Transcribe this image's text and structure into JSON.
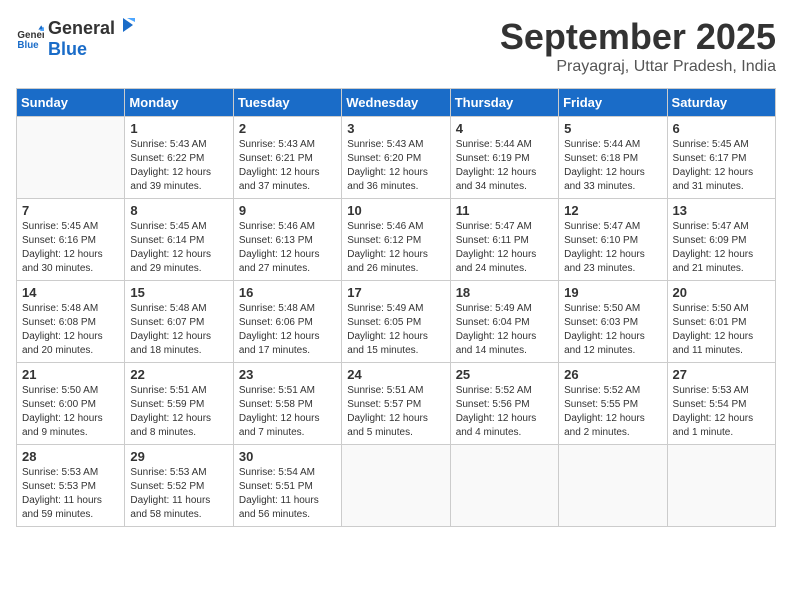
{
  "logo": {
    "general": "General",
    "blue": "Blue"
  },
  "title": "September 2025",
  "subtitle": "Prayagraj, Uttar Pradesh, India",
  "days_of_week": [
    "Sunday",
    "Monday",
    "Tuesday",
    "Wednesday",
    "Thursday",
    "Friday",
    "Saturday"
  ],
  "weeks": [
    [
      {
        "day": "",
        "info": ""
      },
      {
        "day": "1",
        "info": "Sunrise: 5:43 AM\nSunset: 6:22 PM\nDaylight: 12 hours\nand 39 minutes."
      },
      {
        "day": "2",
        "info": "Sunrise: 5:43 AM\nSunset: 6:21 PM\nDaylight: 12 hours\nand 37 minutes."
      },
      {
        "day": "3",
        "info": "Sunrise: 5:43 AM\nSunset: 6:20 PM\nDaylight: 12 hours\nand 36 minutes."
      },
      {
        "day": "4",
        "info": "Sunrise: 5:44 AM\nSunset: 6:19 PM\nDaylight: 12 hours\nand 34 minutes."
      },
      {
        "day": "5",
        "info": "Sunrise: 5:44 AM\nSunset: 6:18 PM\nDaylight: 12 hours\nand 33 minutes."
      },
      {
        "day": "6",
        "info": "Sunrise: 5:45 AM\nSunset: 6:17 PM\nDaylight: 12 hours\nand 31 minutes."
      }
    ],
    [
      {
        "day": "7",
        "info": "Sunrise: 5:45 AM\nSunset: 6:16 PM\nDaylight: 12 hours\nand 30 minutes."
      },
      {
        "day": "8",
        "info": "Sunrise: 5:45 AM\nSunset: 6:14 PM\nDaylight: 12 hours\nand 29 minutes."
      },
      {
        "day": "9",
        "info": "Sunrise: 5:46 AM\nSunset: 6:13 PM\nDaylight: 12 hours\nand 27 minutes."
      },
      {
        "day": "10",
        "info": "Sunrise: 5:46 AM\nSunset: 6:12 PM\nDaylight: 12 hours\nand 26 minutes."
      },
      {
        "day": "11",
        "info": "Sunrise: 5:47 AM\nSunset: 6:11 PM\nDaylight: 12 hours\nand 24 minutes."
      },
      {
        "day": "12",
        "info": "Sunrise: 5:47 AM\nSunset: 6:10 PM\nDaylight: 12 hours\nand 23 minutes."
      },
      {
        "day": "13",
        "info": "Sunrise: 5:47 AM\nSunset: 6:09 PM\nDaylight: 12 hours\nand 21 minutes."
      }
    ],
    [
      {
        "day": "14",
        "info": "Sunrise: 5:48 AM\nSunset: 6:08 PM\nDaylight: 12 hours\nand 20 minutes."
      },
      {
        "day": "15",
        "info": "Sunrise: 5:48 AM\nSunset: 6:07 PM\nDaylight: 12 hours\nand 18 minutes."
      },
      {
        "day": "16",
        "info": "Sunrise: 5:48 AM\nSunset: 6:06 PM\nDaylight: 12 hours\nand 17 minutes."
      },
      {
        "day": "17",
        "info": "Sunrise: 5:49 AM\nSunset: 6:05 PM\nDaylight: 12 hours\nand 15 minutes."
      },
      {
        "day": "18",
        "info": "Sunrise: 5:49 AM\nSunset: 6:04 PM\nDaylight: 12 hours\nand 14 minutes."
      },
      {
        "day": "19",
        "info": "Sunrise: 5:50 AM\nSunset: 6:03 PM\nDaylight: 12 hours\nand 12 minutes."
      },
      {
        "day": "20",
        "info": "Sunrise: 5:50 AM\nSunset: 6:01 PM\nDaylight: 12 hours\nand 11 minutes."
      }
    ],
    [
      {
        "day": "21",
        "info": "Sunrise: 5:50 AM\nSunset: 6:00 PM\nDaylight: 12 hours\nand 9 minutes."
      },
      {
        "day": "22",
        "info": "Sunrise: 5:51 AM\nSunset: 5:59 PM\nDaylight: 12 hours\nand 8 minutes."
      },
      {
        "day": "23",
        "info": "Sunrise: 5:51 AM\nSunset: 5:58 PM\nDaylight: 12 hours\nand 7 minutes."
      },
      {
        "day": "24",
        "info": "Sunrise: 5:51 AM\nSunset: 5:57 PM\nDaylight: 12 hours\nand 5 minutes."
      },
      {
        "day": "25",
        "info": "Sunrise: 5:52 AM\nSunset: 5:56 PM\nDaylight: 12 hours\nand 4 minutes."
      },
      {
        "day": "26",
        "info": "Sunrise: 5:52 AM\nSunset: 5:55 PM\nDaylight: 12 hours\nand 2 minutes."
      },
      {
        "day": "27",
        "info": "Sunrise: 5:53 AM\nSunset: 5:54 PM\nDaylight: 12 hours\nand 1 minute."
      }
    ],
    [
      {
        "day": "28",
        "info": "Sunrise: 5:53 AM\nSunset: 5:53 PM\nDaylight: 11 hours\nand 59 minutes."
      },
      {
        "day": "29",
        "info": "Sunrise: 5:53 AM\nSunset: 5:52 PM\nDaylight: 11 hours\nand 58 minutes."
      },
      {
        "day": "30",
        "info": "Sunrise: 5:54 AM\nSunset: 5:51 PM\nDaylight: 11 hours\nand 56 minutes."
      },
      {
        "day": "",
        "info": ""
      },
      {
        "day": "",
        "info": ""
      },
      {
        "day": "",
        "info": ""
      },
      {
        "day": "",
        "info": ""
      }
    ]
  ]
}
